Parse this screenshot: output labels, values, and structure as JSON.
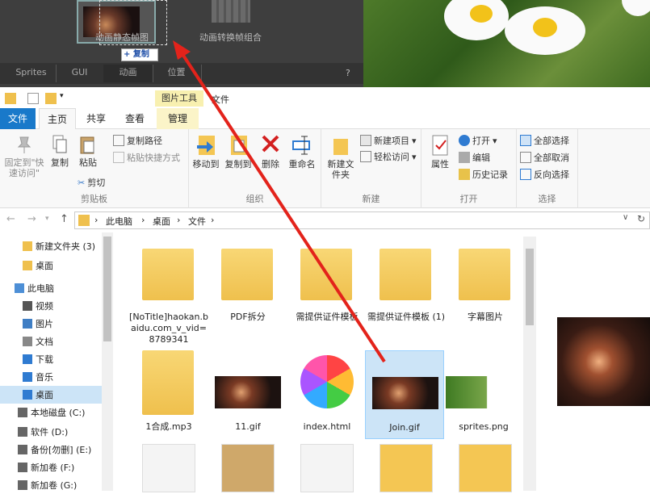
{
  "top_app": {
    "thumb1_label": "动画静态帧图",
    "thumb2_label": "动画转换帧组合",
    "copy_badge": "+ 复制",
    "tabs": [
      "Sprites",
      "GUI",
      "动画",
      "位置"
    ],
    "help": "?"
  },
  "explorer": {
    "context_tab": "图片工具",
    "window_title": "文件",
    "ribbon_tabs": [
      "文件",
      "主页",
      "共享",
      "查看",
      "管理"
    ],
    "clipboard": {
      "pin": "固定到\"快速访问\"",
      "copy": "复制",
      "paste": "粘贴",
      "copy_path": "复制路径",
      "paste_shortcut": "粘贴快捷方式",
      "cut": "剪切",
      "group": "剪贴板"
    },
    "organize": {
      "move_to": "移动到",
      "copy_to": "复制到",
      "delete": "删除",
      "rename": "重命名",
      "group": "组织"
    },
    "new": {
      "new_folder": "新建文件夹",
      "new_item": "新建项目",
      "easy_access": "轻松访问",
      "group": "新建"
    },
    "open": {
      "properties": "属性",
      "open": "打开",
      "edit": "编辑",
      "history": "历史记录",
      "group": "打开"
    },
    "select": {
      "select_all": "全部选择",
      "select_none": "全部取消",
      "invert": "反向选择",
      "group": "选择"
    },
    "breadcrumb": [
      "此电脑",
      "桌面",
      "文件"
    ],
    "sidebar": [
      {
        "label": "新建文件夹 (3)",
        "icon": "folder-icon"
      },
      {
        "label": "桌面",
        "icon": "folder-icon"
      },
      {
        "label": "此电脑",
        "icon": "computer-icon"
      },
      {
        "label": "视频",
        "icon": "video-icon"
      },
      {
        "label": "图片",
        "icon": "picture-icon"
      },
      {
        "label": "文档",
        "icon": "document-icon"
      },
      {
        "label": "下载",
        "icon": "download-icon"
      },
      {
        "label": "音乐",
        "icon": "music-icon"
      },
      {
        "label": "桌面",
        "icon": "desktop-icon"
      },
      {
        "label": "本地磁盘 (C:)",
        "icon": "drive-icon"
      },
      {
        "label": "软件 (D:)",
        "icon": "drive-icon"
      },
      {
        "label": "备份[勿删] (E:)",
        "icon": "drive-icon"
      },
      {
        "label": "新加卷 (F:)",
        "icon": "drive-icon"
      },
      {
        "label": "新加卷 (G:)",
        "icon": "drive-icon"
      }
    ],
    "files": [
      {
        "name": "[NoTitle]haokan.baidu.com_v_vid=8789341",
        "type": "folder"
      },
      {
        "name": "PDF拆分",
        "type": "folder"
      },
      {
        "name": "需提供证件模板",
        "type": "folder"
      },
      {
        "name": "需提供证件模板 (1)",
        "type": "folder"
      },
      {
        "name": "字幕图片",
        "type": "folder"
      },
      {
        "name": "1合成.mp3",
        "type": "folder-images"
      },
      {
        "name": "11.gif",
        "type": "gif"
      },
      {
        "name": "index.html",
        "type": "html"
      },
      {
        "name": "Join.gif",
        "type": "gif"
      },
      {
        "name": "sprites.png",
        "type": "png"
      }
    ]
  }
}
